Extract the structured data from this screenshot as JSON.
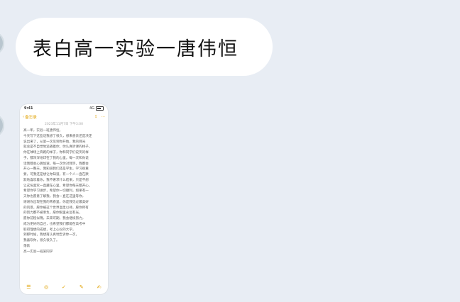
{
  "message": {
    "text": "表白高一实验一唐伟恒"
  },
  "screenshot": {
    "status_time": "9:41",
    "status_signal": "4G",
    "nav_back": "备忘录",
    "meta": "2023年11月7日 下午3:00",
    "lines": [
      "高一年，实验一班唐伟恒，",
      "今天写下这些话我想了很久，想来想去还是决定",
      "说出来了，从第一次见到你开始，我的目光",
      "就总是不自觉地追随着你，你认真听课的样子，",
      "你在球场上奔跑的样子，你和同学们说笑的样",
      "子，都深深地印在了我的心里，每一次和你说",
      "话我都会心跳加速，每一次你对我笑，我都会",
      "开心一整天，我知道我们还是学生，学习很重",
      "要，可我还是想让你知道，有一个人一直在默",
      "默地喜欢着你，我不奢求什么结果，只是不想",
      "让这份喜欢一直藏在心里，希望你每天都开心，",
      "希望你学习进步，希望你一切顺利，如果有一",
      "天你也愿意了解我，我会一直在这里等你，",
      "谢谢你出现在我的青春里，你是我见过最美好",
      "的风景，愿你被这个世界温柔以待，愿你所有",
      "的努力都不被辜负，愿你眼里永远有光，",
      "愿你前程似锦，未来可期，我会继续努力，",
      "成为更好的自己，也希望我们都能在高考中",
      "取得理想的成绩，考上心仪的大学，",
      "到那时候，我想再认真地告诉你一次，",
      "我喜欢你，很久很久了。",
      "落款",
      "高一实验一班某同学"
    ],
    "toolbar_icons": [
      "list-icon",
      "camera-icon",
      "checklist-icon",
      "draw-icon",
      "compose-icon"
    ],
    "accent_color": "#e0a100"
  }
}
